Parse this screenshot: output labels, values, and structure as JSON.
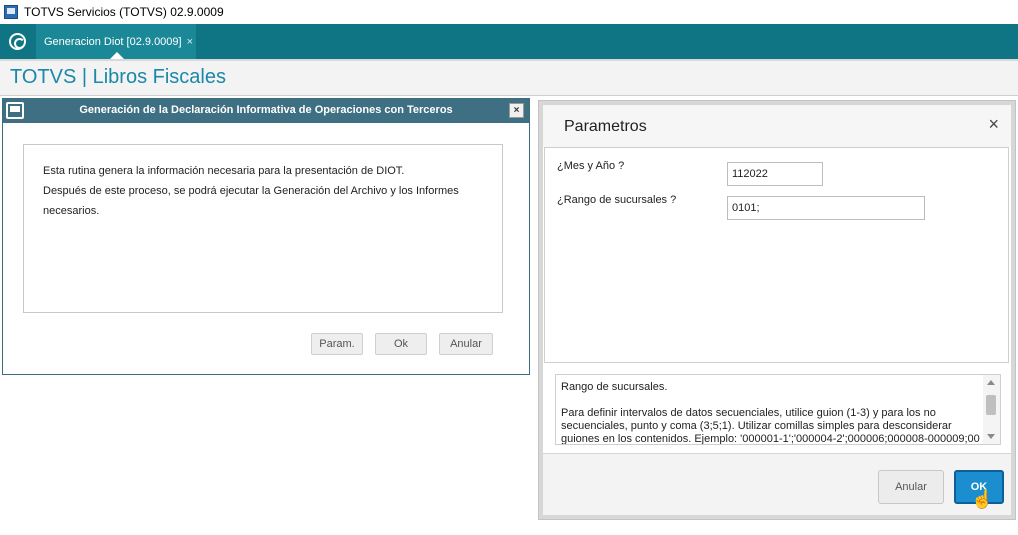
{
  "window": {
    "title": "TOTVS Servicios (TOTVS) 02.9.0009"
  },
  "tabs": [
    {
      "label": "Generacion Diot [02.9.0009]",
      "close": "×"
    }
  ],
  "module": {
    "title": "TOTVS | Libros Fiscales"
  },
  "left_dialog": {
    "title": "Generación de la Declaración Informativa de Operaciones con Terceros",
    "close": "×",
    "lines": [
      "Esta rutina genera la información necesaria para la presentación de  DIOT.",
      "Después de este proceso, se podrá ejecutar la Generación del Archivo y los Informes",
      "necesarios."
    ],
    "buttons": {
      "param": "Param.",
      "ok": "Ok",
      "anular": "Anular"
    }
  },
  "right_dialog": {
    "title": "Parametros",
    "close": "×",
    "fields": [
      {
        "label": "¿Mes y Año ?",
        "value": "112022"
      },
      {
        "label": "¿Rango de sucursales ?",
        "value": "0101;"
      }
    ],
    "help": {
      "title": "Rango de sucursales.",
      "body": "Para definir intervalos de datos secuenciales, utilice guion (1-3) y para los no secuenciales, punto y coma (3;5;1). Utilizar comillas simples para desconsiderar guiones en los contenidos. Ejemplo: '000001-1';'000004-2';000006;000008-000009;00"
    },
    "buttons": {
      "anular": "Anular",
      "ok": "OK"
    }
  },
  "icons": [
    "app-icon",
    "totvs-logo-icon",
    "dialog-window-icon",
    "close-icon",
    "mouse-pointer-icon"
  ],
  "colors": {
    "tabbar": "#0f7585",
    "module_title": "#1a88a8",
    "dialog_header": "#3e6f82",
    "ok_button": "#1b8ed0"
  }
}
